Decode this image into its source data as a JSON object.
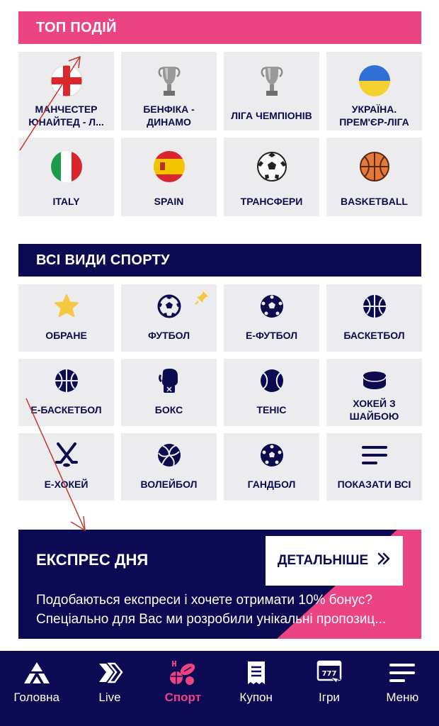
{
  "top_events": {
    "header": "ТОП ПОДІЙ",
    "items": [
      {
        "label": "МАНЧЕСТЕР ЮНАЙТЕД - Л...",
        "icon": "england-flag-icon"
      },
      {
        "label": "БЕНФІКА - ДИНАМО",
        "icon": "trophy-icon"
      },
      {
        "label": "ЛІГА ЧЕМПІОНІВ",
        "icon": "trophy-icon"
      },
      {
        "label": "УКРАЇНА. ПРЕМ'ЄР-ЛІГА",
        "icon": "ukraine-flag-icon"
      },
      {
        "label": "ITALY",
        "icon": "italy-flag-icon"
      },
      {
        "label": "SPAIN",
        "icon": "spain-flag-icon"
      },
      {
        "label": "ТРАНСФЕРИ",
        "icon": "soccer-ball-icon"
      },
      {
        "label": "BASKETBALL",
        "icon": "basketball-icon"
      }
    ]
  },
  "all_sports": {
    "header": "ВСІ ВИДИ СПОРТУ",
    "items": [
      {
        "label": "ОБРАНЕ",
        "icon": "star-icon"
      },
      {
        "label": "ФУТБОЛ",
        "icon": "soccer-ball-icon"
      },
      {
        "label": "Е-ФУТБОЛ",
        "icon": "e-football-icon"
      },
      {
        "label": "БАСКЕТБОЛ",
        "icon": "basketball-icon"
      },
      {
        "label": "Е-БАСКЕТБОЛ",
        "icon": "e-basketball-icon"
      },
      {
        "label": "БОКС",
        "icon": "boxing-glove-icon"
      },
      {
        "label": "ТЕНІС",
        "icon": "tennis-ball-icon"
      },
      {
        "label": "ХОКЕЙ З ШАЙБОЮ",
        "icon": "hockey-puck-icon"
      },
      {
        "label": "Е-ХОКЕЙ",
        "icon": "hockey-sticks-icon"
      },
      {
        "label": "ВОЛЕЙБОЛ",
        "icon": "volleyball-icon"
      },
      {
        "label": "ГАНДБОЛ",
        "icon": "handball-icon"
      },
      {
        "label": "ПОКАЗАТИ ВСІ",
        "icon": "menu-lines-icon"
      }
    ]
  },
  "express": {
    "title": "ЕКСПРЕС ДНЯ",
    "button": "ДЕТАЛЬНІШЕ",
    "line1": "Подобаються експреси і хочете отримати 10% бонус?",
    "line2": "Спеціально для Вас ми розробили унікальні пропозиц..."
  },
  "bottom_nav": {
    "items": [
      {
        "label": "Головна",
        "icon": "home-logo-icon"
      },
      {
        "label": "Live",
        "icon": "live-icon"
      },
      {
        "label": "Спорт",
        "icon": "sport-icon"
      },
      {
        "label": "Купон",
        "icon": "coupon-icon"
      },
      {
        "label": "Ігри",
        "icon": "games-icon"
      },
      {
        "label": "Меню",
        "icon": "menu-icon"
      }
    ],
    "active": "Спорт"
  },
  "colors": {
    "pink": "#ec4383",
    "navy": "#0c0a52",
    "tile": "#ececee",
    "star": "#f5c842"
  }
}
